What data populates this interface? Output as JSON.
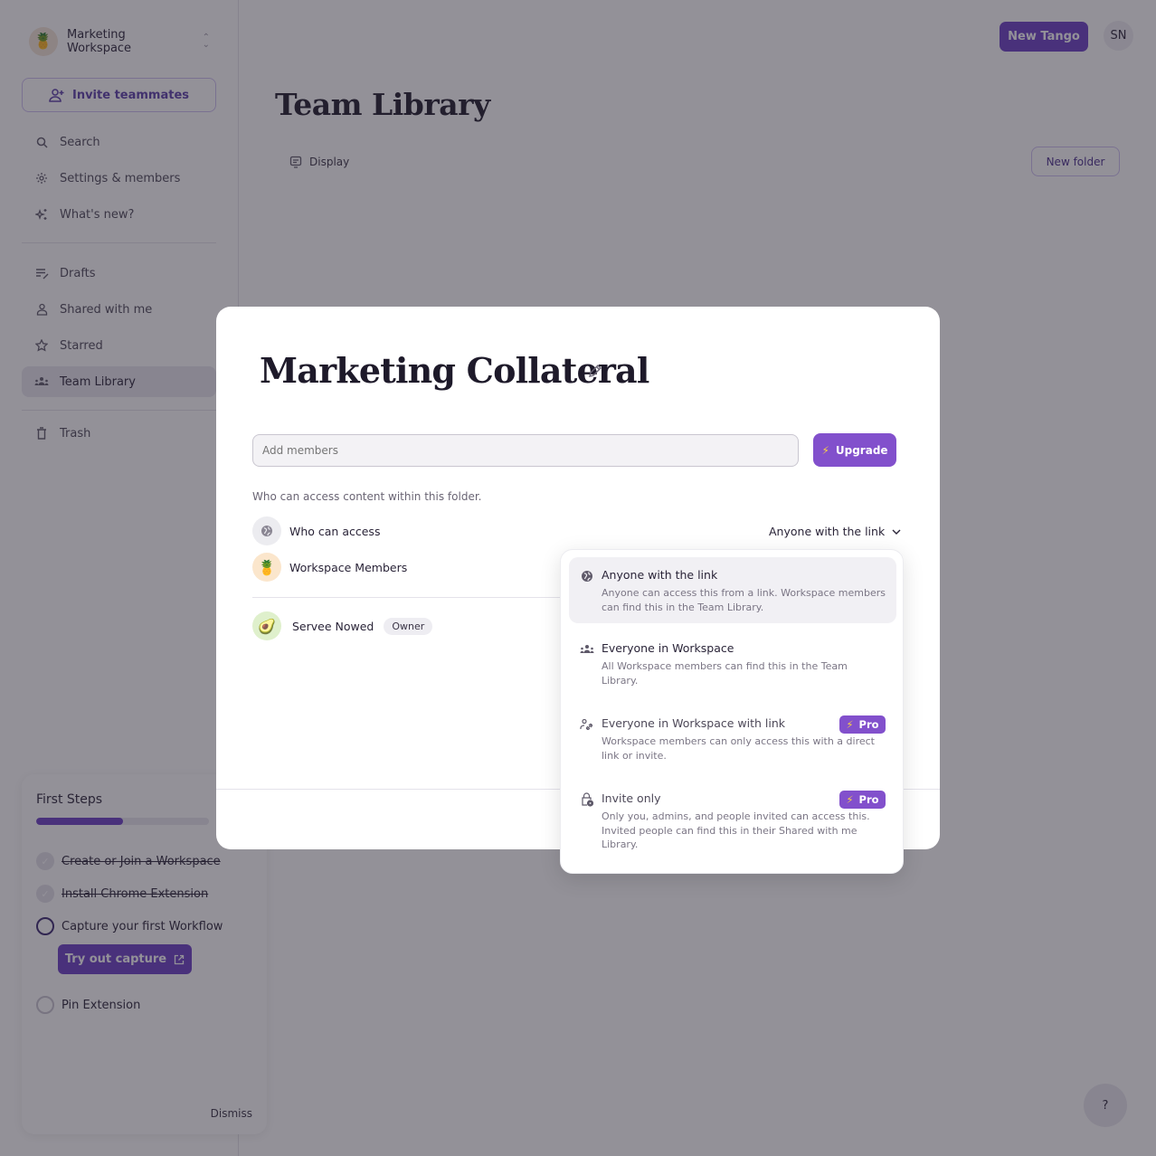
{
  "sidebar": {
    "workspace_name": "Marketing Workspace",
    "workspace_avatar": "🍍",
    "invite_label": "Invite teammates",
    "nav_top": [
      {
        "label": "Search",
        "icon": "search-icon"
      },
      {
        "label": "Settings & members",
        "icon": "gear-icon"
      },
      {
        "label": "What's new?",
        "icon": "sparkle-icon"
      }
    ],
    "nav_main": [
      {
        "label": "Drafts",
        "icon": "drafts-icon"
      },
      {
        "label": "Shared with me",
        "icon": "person-icon"
      },
      {
        "label": "Starred",
        "icon": "star-icon"
      },
      {
        "label": "Team Library",
        "icon": "team-icon",
        "active": true
      }
    ],
    "trash_label": "Trash"
  },
  "header": {
    "new_tango_label": "New Tango",
    "user_initials": "SN",
    "page_title": "Team Library",
    "display_label": "Display",
    "new_folder_label": "New folder"
  },
  "first_steps": {
    "title": "First Steps",
    "progress_percent": 50,
    "items": [
      {
        "label": "Create or Join a Workspace",
        "status": "done"
      },
      {
        "label": "Install Chrome Extension",
        "status": "done"
      },
      {
        "label": "Capture your first Workflow",
        "status": "current"
      },
      {
        "label": "Pin Extension",
        "status": "todo"
      }
    ],
    "try_capture_label": "Try out capture",
    "dismiss_label": "Dismiss"
  },
  "help": {
    "label": "?"
  },
  "modal": {
    "title": "Marketing Collateral",
    "add_members_placeholder": "Add members",
    "upgrade_label": "Upgrade",
    "access_caption": "Who can access content within this folder.",
    "who_can_access_label": "Who can access",
    "access_value": "Anyone with the link",
    "workspace_members_label": "Workspace Members",
    "workspace_members_avatar": "🍍",
    "owner": {
      "name": "Servee Nowed",
      "role": "Owner",
      "avatar": "🥑"
    }
  },
  "access_dropdown": {
    "options": [
      {
        "title": "Anyone with the link",
        "description": "Anyone can access this from a link. Workspace members can find this in the Team Library.",
        "icon": "globe-icon",
        "selected": true
      },
      {
        "title": "Everyone in Workspace",
        "description": "All Workspace members can find this in the Team Library.",
        "icon": "team-icon"
      },
      {
        "title": "Everyone in Workspace with link",
        "description": "Workspace members can only access this with a direct link or invite.",
        "icon": "people-link-icon",
        "badge": "Pro"
      },
      {
        "title": "Invite only",
        "description": "Only you, admins, and people invited can access this. Invited people can find this in their Shared with me Library.",
        "icon": "lock-icon",
        "badge": "Pro"
      }
    ]
  },
  "colors": {
    "accent": "#6b3fc4",
    "upgrade": "#8250cc",
    "bolt": "#f8d343",
    "overlay": "rgba(40,36,50,0.5)"
  }
}
